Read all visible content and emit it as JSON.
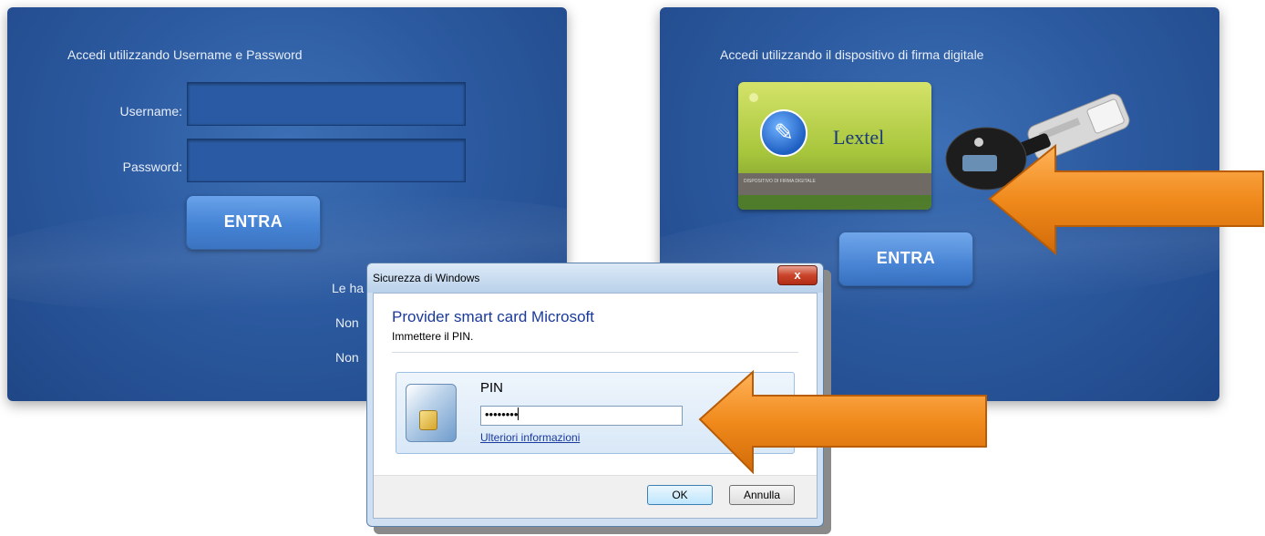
{
  "left_panel": {
    "title": "Accedi utilizzando Username e Password",
    "username_label": "Username:",
    "username_value": "",
    "password_label": "Password:",
    "password_value": "",
    "enter_label": "ENTRA",
    "links": [
      "Le ha",
      "Non",
      "Non"
    ]
  },
  "right_panel": {
    "title": "Accedi utilizzando il dispositivo di firma digitale",
    "card_brand": "Lextel",
    "card_small_text": "DISPOSITIVO DI FIRMA DIGITALE",
    "enter_label": "ENTRA"
  },
  "dialog": {
    "title": "Sicurezza di Windows",
    "close_label": "x",
    "heading": "Provider smart card Microsoft",
    "subheading": "Immettere il PIN.",
    "pin_label": "PIN",
    "pin_value": "••••••••",
    "more_info": "Ulteriori informazioni",
    "ok_label": "OK",
    "cancel_label": "Annulla"
  },
  "colors": {
    "panel_blue": "#2c5aa0",
    "button_blue": "#3f7fd3",
    "arrow_orange": "#f08a1c",
    "card_green": "#a8c63c",
    "dialog_heading": "#1a3a9a"
  },
  "icons": {
    "card_badge": "signature-icon",
    "token": "usb-token-icon",
    "dialog_card": "smartcard-icon"
  }
}
